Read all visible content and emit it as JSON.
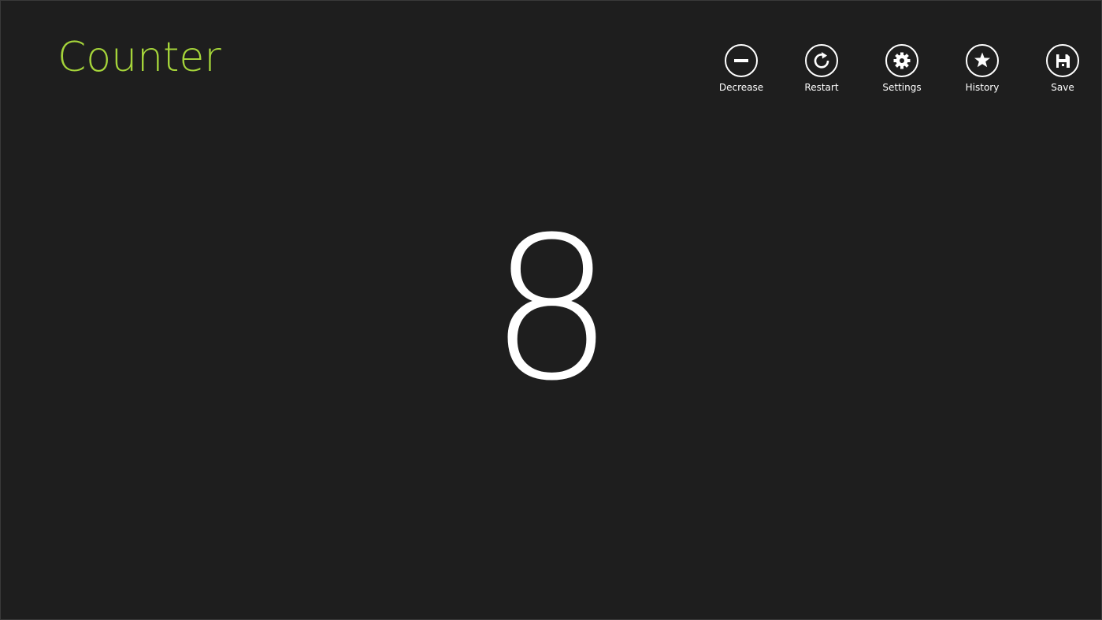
{
  "app": {
    "title": "Counter",
    "accent_color": "#a5d43a",
    "background_color": "#1e1e1e"
  },
  "toolbar": {
    "items": [
      {
        "label": "Decrease",
        "icon": "minus-icon"
      },
      {
        "label": "Restart",
        "icon": "refresh-icon"
      },
      {
        "label": "Settings",
        "icon": "gear-icon"
      },
      {
        "label": "History",
        "icon": "star-icon"
      },
      {
        "label": "Save",
        "icon": "floppy-disk-icon"
      }
    ]
  },
  "counter": {
    "value": "8"
  }
}
